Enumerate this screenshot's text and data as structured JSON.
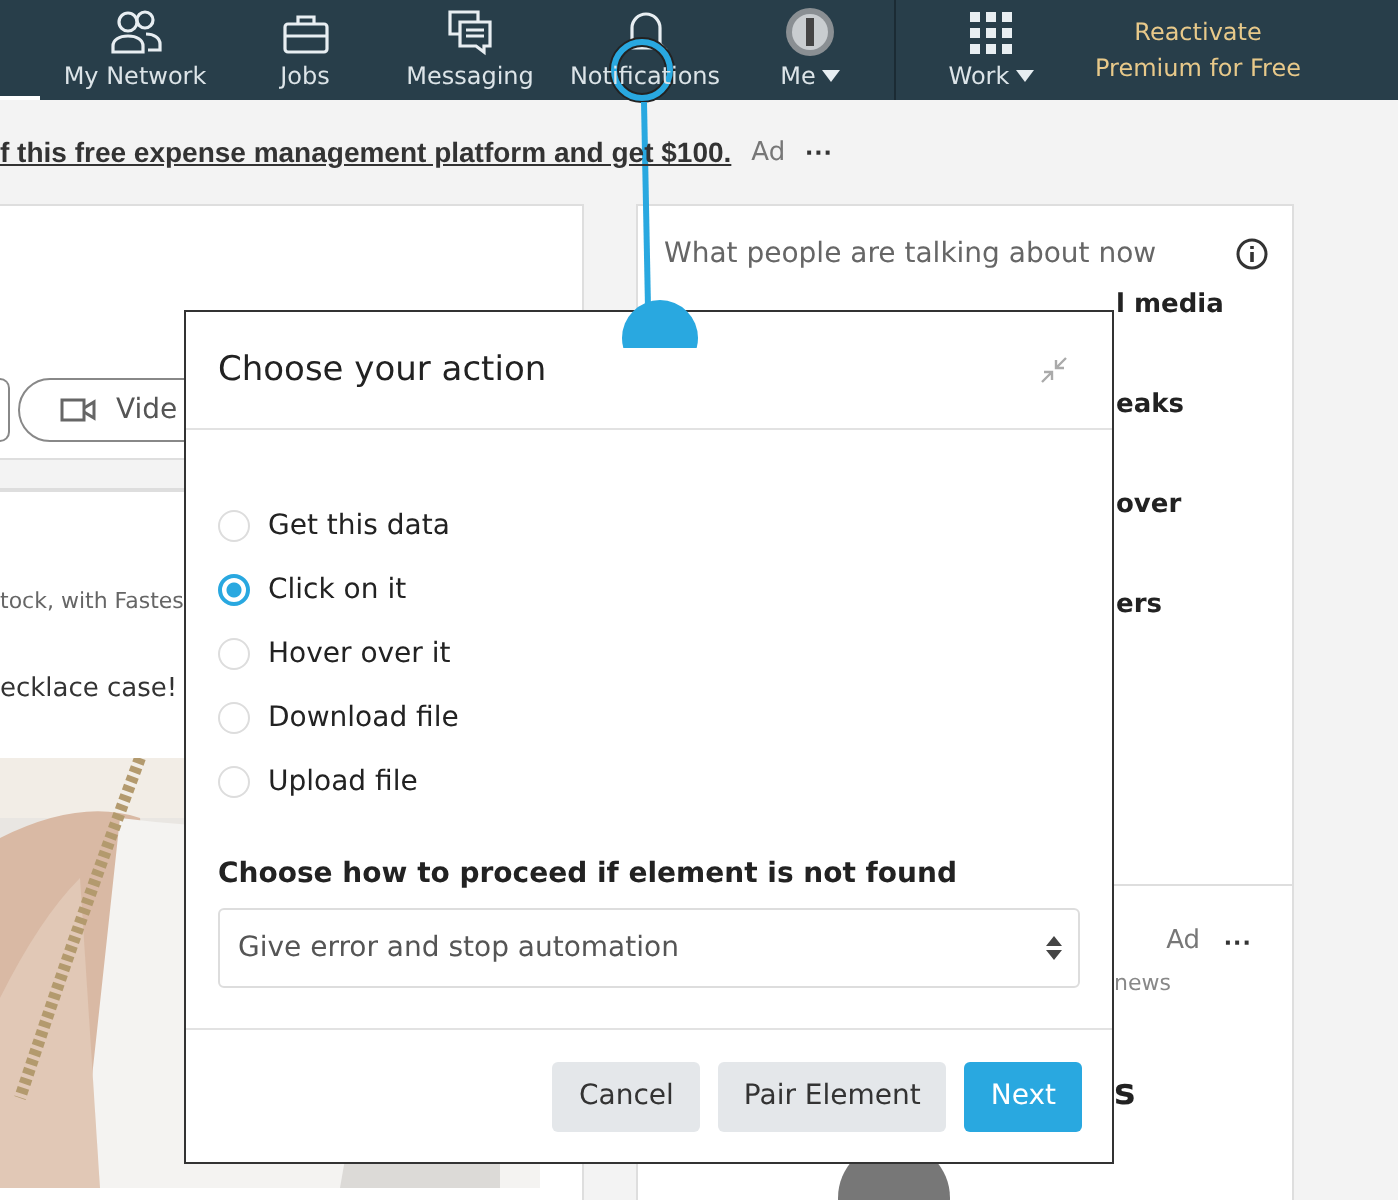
{
  "navbar": {
    "items": [
      {
        "kind": "network",
        "label": "My Network",
        "dropdown": false
      },
      {
        "kind": "jobs",
        "label": "Jobs",
        "dropdown": false
      },
      {
        "kind": "messaging",
        "label": "Messaging",
        "dropdown": false
      },
      {
        "kind": "notifications",
        "label": "Notifications",
        "dropdown": false
      },
      {
        "kind": "me",
        "label": "Me",
        "dropdown": true
      },
      {
        "kind": "work",
        "label": "Work",
        "dropdown": true
      }
    ],
    "premium": [
      "Reactivate",
      "Premium for Free"
    ]
  },
  "ad_banner": {
    "text": "f this free expense management platform and get $100.",
    "badge": "Ad",
    "more": "···"
  },
  "share_box": {
    "video_button": "Vide"
  },
  "post": {
    "lines": [
      "tock, with Fastes",
      "ecklace case!"
    ],
    "image": {
      "kind": "picture"
    }
  },
  "trending": {
    "title": "What people are talking about now",
    "fragments": [
      "l media",
      "eaks",
      "over",
      "ers"
    ]
  },
  "ad_card": {
    "badge": "Ad",
    "more": "···",
    "fragments": [
      "news",
      "s"
    ]
  },
  "dialog": {
    "title": "Choose your action",
    "options": [
      {
        "label": "Get this data",
        "selected": false
      },
      {
        "label": "Click on it",
        "selected": true
      },
      {
        "label": "Hover over it",
        "selected": false
      },
      {
        "label": "Download file",
        "selected": false
      },
      {
        "label": "Upload file",
        "selected": false
      }
    ],
    "fallback_label": "Choose how to proceed if element is not found",
    "fallback_value": "Give error and stop automation",
    "buttons": [
      {
        "label": "Cancel",
        "kind": "secondary"
      },
      {
        "label": "Pair Element",
        "kind": "secondary"
      },
      {
        "label": "Next",
        "kind": "primary"
      }
    ]
  }
}
